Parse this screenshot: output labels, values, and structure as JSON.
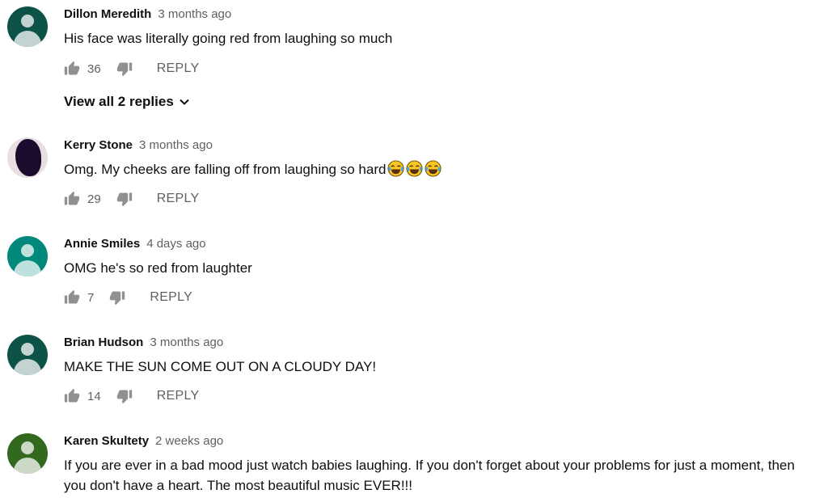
{
  "comments": [
    {
      "author": "Dillon Meredith",
      "time": "3 months ago",
      "text": "His face was literally going red from laughing so much",
      "likes": "36",
      "reply_label": "REPLY",
      "avatar_color": "#0d5247",
      "view_replies": "View all 2 replies"
    },
    {
      "author": "Kerry Stone",
      "time": "3 months ago",
      "text": "Omg. My cheeks are falling off from laughing so hard",
      "emojis": [
        "face-with-tears-of-joy",
        "face-with-tears-of-joy",
        "face-with-tears-of-joy"
      ],
      "likes": "29",
      "reply_label": "REPLY"
    },
    {
      "author": "Annie Smiles",
      "time": "4 days ago",
      "text": "OMG he's so red from laughter",
      "likes": "7",
      "reply_label": "REPLY",
      "avatar_color": "#00897b"
    },
    {
      "author": "Brian Hudson",
      "time": "3 months ago",
      "text": "MAKE THE SUN COME OUT ON A CLOUDY DAY!",
      "likes": "14",
      "reply_label": "REPLY",
      "avatar_color": "#0d5247"
    },
    {
      "author": "Karen Skultety",
      "time": "2 weeks ago",
      "text": "If you are ever in a bad mood just watch babies laughing. If you don't forget about your problems for just a moment, then you don't have a heart. The most beautiful music EVER!!!",
      "avatar_color": "#33691e"
    }
  ],
  "icons": {
    "like": "thumb-up-icon",
    "dislike": "thumb-down-icon",
    "expand": "chevron-down-icon"
  },
  "colors": {
    "secondary_text": "#606060",
    "icon": "#909090"
  }
}
